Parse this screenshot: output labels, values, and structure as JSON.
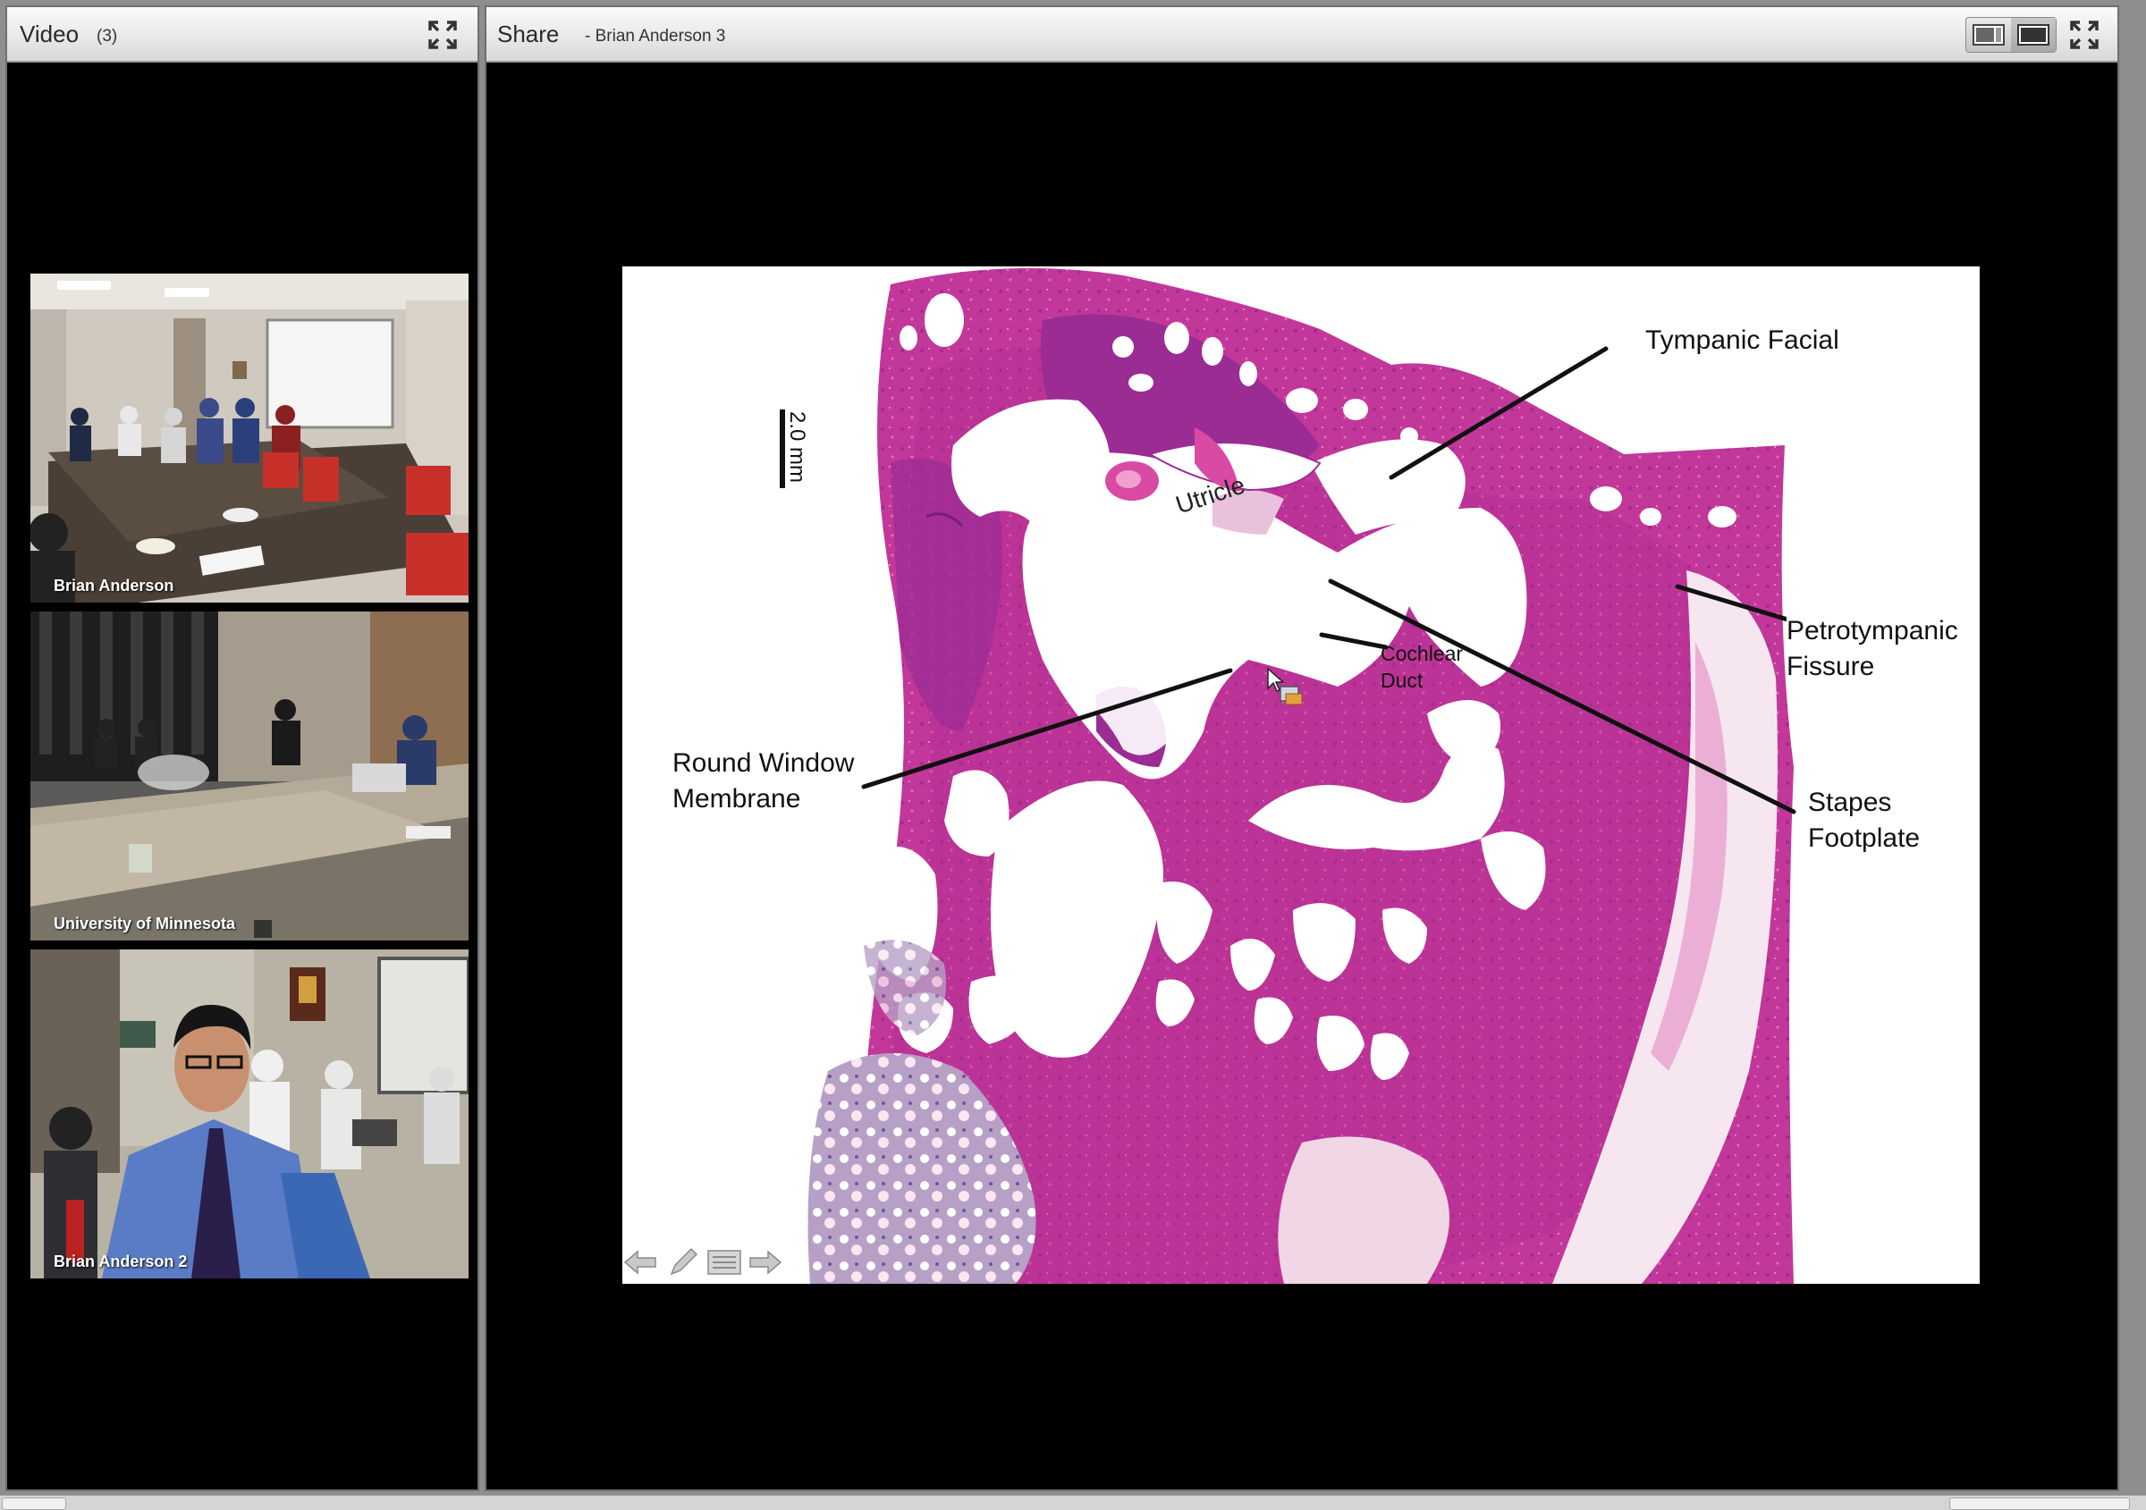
{
  "video_pod": {
    "title": "Video",
    "count": "(3)",
    "expand_icon": "fullscreen-icon",
    "tiles": [
      {
        "label": "Brian Anderson"
      },
      {
        "label": "University of Minnesota"
      },
      {
        "label": "Brian Anderson 2"
      }
    ]
  },
  "share_pod": {
    "title": "Share",
    "presenter": "- Brian Anderson 3",
    "layout_icons": [
      "layout-sidebar-icon",
      "layout-fill-icon"
    ],
    "expand_icon": "fullscreen-icon"
  },
  "slide": {
    "scale_bar": "2.0 mm",
    "labels": {
      "utricle": "Utricle",
      "tympanic_facial": "Tympanic Facial",
      "petrotympanic_1": "Petrotympanic",
      "petrotympanic_2": "Fissure",
      "cochlear_1": "Cochlear",
      "cochlear_2": "Duct",
      "round_window_1": "Round Window",
      "round_window_2": "Membrane",
      "stapes_1": "Stapes",
      "stapes_2": "Footplate"
    },
    "nav_icons": [
      "previous-arrow-icon",
      "pencil-icon",
      "list-icon",
      "next-arrow-icon"
    ]
  },
  "colors": {
    "tissue_dark": "#9a2c94",
    "tissue_mid": "#c2379a",
    "tissue_light": "#e58ac3",
    "pod_header": "#e6e6e6"
  }
}
